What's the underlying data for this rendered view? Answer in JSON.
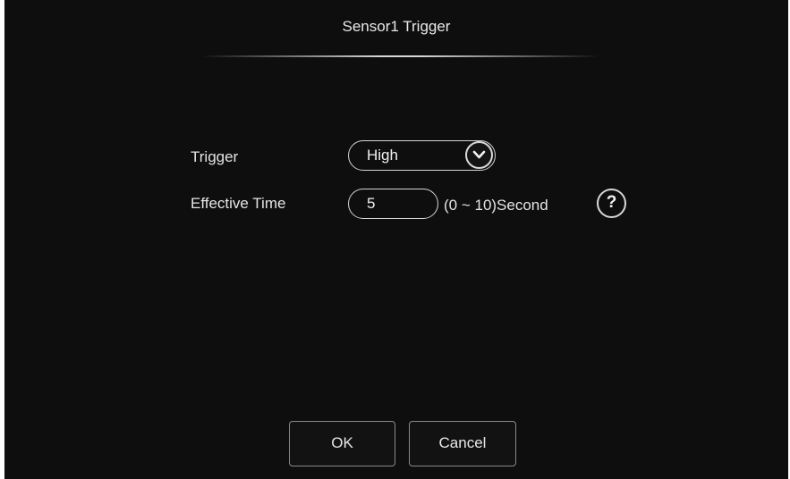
{
  "dialog": {
    "title": "Sensor1 Trigger"
  },
  "form": {
    "trigger": {
      "label": "Trigger",
      "selected": "High"
    },
    "effective_time": {
      "label": "Effective Time",
      "value": "5",
      "range_hint": "(0 ~ 10)Second"
    }
  },
  "icons": {
    "dropdown": "chevron-down-icon",
    "help": "question-mark-icon",
    "help_glyph": "?"
  },
  "buttons": {
    "ok": "OK",
    "cancel": "Cancel"
  },
  "colors": {
    "background": "#0e0e0e",
    "text": "#e6e6e6",
    "border": "#d5d5d5"
  }
}
